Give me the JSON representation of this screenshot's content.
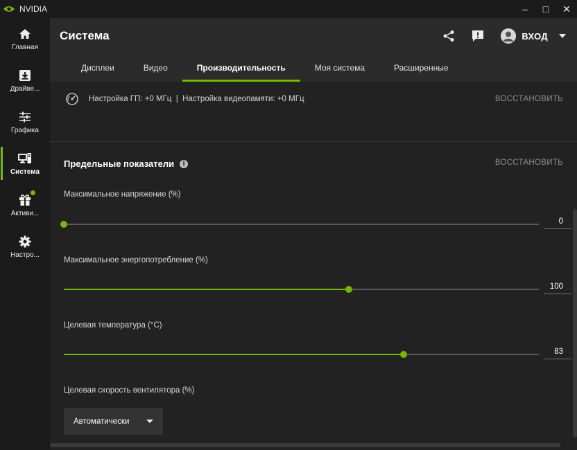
{
  "window": {
    "title": "NVIDIA",
    "controls": {
      "minimize": "–",
      "maximize": "□",
      "close": "✕"
    }
  },
  "colors": {
    "accent": "#76b900",
    "background": "#1b1b1b",
    "panel": "#2b2b2b",
    "content": "#222222"
  },
  "sidebar": {
    "items": [
      {
        "label": "Главная",
        "icon": "home-icon"
      },
      {
        "label": "Драйве...",
        "icon": "download-icon"
      },
      {
        "label": "Графика",
        "icon": "sliders-icon"
      },
      {
        "label": "Система",
        "icon": "computer-icon",
        "active": true
      },
      {
        "label": "Активи...",
        "icon": "gift-icon",
        "notification": true
      },
      {
        "label": "Настро...",
        "icon": "gear-icon"
      }
    ]
  },
  "header": {
    "title": "Система",
    "login_label": "ВХОД"
  },
  "tabs": [
    {
      "label": "Дисплеи"
    },
    {
      "label": "Видео"
    },
    {
      "label": "Производительность",
      "active": true
    },
    {
      "label": "Моя система"
    },
    {
      "label": "Расширенные"
    }
  ],
  "overclock": {
    "text": "Настройка ГП: +0 МГц  |  Настройка видеопамяти: +0 МГц",
    "reset_label": "ВОССТАНОВИТЬ"
  },
  "limits": {
    "title": "Предельные показатели",
    "info_glyph": "i",
    "reset_label": "ВОССТАНОВИТЬ",
    "sliders": [
      {
        "label": "Максимальное напряжение (%)",
        "value": "0",
        "position": 0.0
      },
      {
        "label": "Максимальное энергопотребление (%)",
        "value": "100",
        "position": 0.6
      },
      {
        "label": "Целевая температура (°C)",
        "value": "83",
        "position": 0.715
      }
    ],
    "fan": {
      "label": "Целевая скорость вентилятора (%)",
      "selected": "Автоматически"
    }
  }
}
